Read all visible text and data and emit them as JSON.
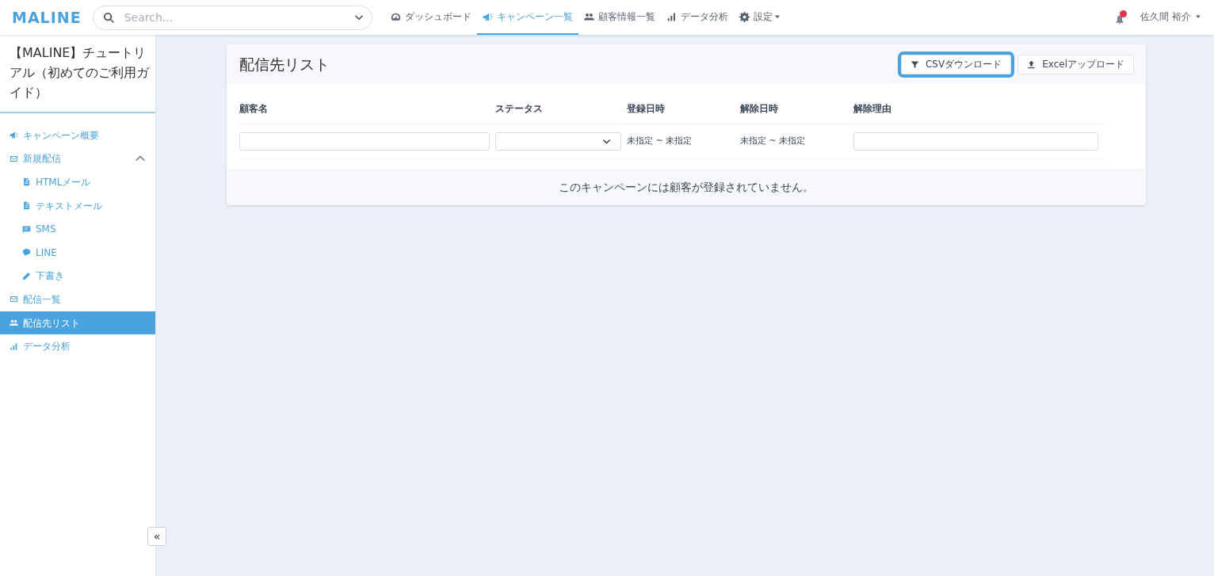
{
  "navbar": {
    "logo": "MALINE",
    "search": {
      "placeholder": "Search..."
    },
    "nav_items": [
      {
        "label": "ダッシュボード",
        "selected": false,
        "dropdown": false
      },
      {
        "label": "キャンペーン一覧",
        "selected": true,
        "dropdown": false
      },
      {
        "label": "顧客情報一覧",
        "selected": false,
        "dropdown": false
      },
      {
        "label": "データ分析",
        "selected": false,
        "dropdown": false
      },
      {
        "label": "設定",
        "selected": false,
        "dropdown": true
      }
    ],
    "notification": true,
    "user": "佐久間 裕介"
  },
  "sidebar": {
    "title": "【MALINE】チュートリアル（初めてのご利用ガイド）",
    "items": [
      {
        "label": "キャンペーン概要",
        "selected": false
      },
      {
        "label": "新規配信",
        "selected": false,
        "expanded": true,
        "children": [
          {
            "label": "HTMLメール",
            "selected": false
          },
          {
            "label": "テキストメール",
            "selected": false
          },
          {
            "label": "SMS",
            "selected": false
          },
          {
            "label": "LINE",
            "selected": false
          },
          {
            "label": "下書き",
            "selected": false
          }
        ]
      },
      {
        "label": "配信一覧",
        "selected": false
      },
      {
        "label": "配信先リスト",
        "selected": true
      },
      {
        "label": "データ分析",
        "selected": false
      }
    ],
    "collapse_button": "«"
  },
  "card": {
    "title": "配信先リスト",
    "buttons": [
      {
        "label": "CSVダウンロード",
        "highlighted": true
      },
      {
        "label": "Excelアップロード",
        "highlighted": false
      }
    ],
    "table": {
      "columns": [
        "顧客名",
        "ステータス",
        "登録日時",
        "解除日時",
        "解除理由"
      ],
      "filters": [
        {
          "kind": "text"
        },
        {
          "kind": "select"
        },
        {
          "kind": "range",
          "value": "未指定 ~ 未指定"
        },
        {
          "kind": "range",
          "value": "未指定 ~ 未指定"
        },
        {
          "kind": "text"
        }
      ],
      "empty_message": "このキャンペーンには顧客が登録されていません。"
    }
  }
}
